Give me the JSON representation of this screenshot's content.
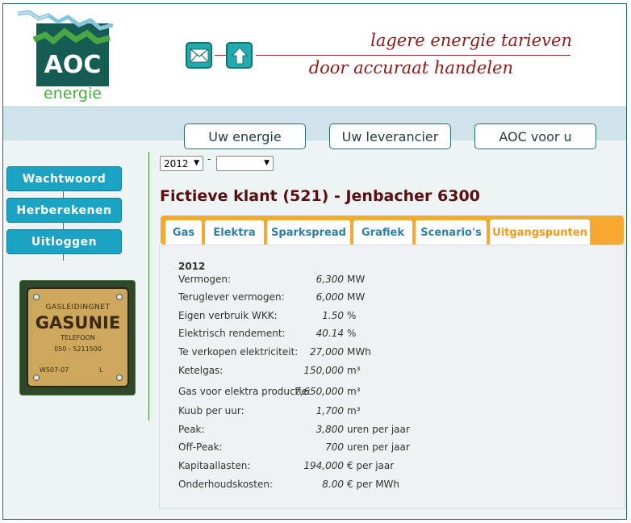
{
  "brand": {
    "name": "AOC",
    "sub": "energie",
    "tagline1": "lagere energie tarieven",
    "tagline2": "door accuraat handelen"
  },
  "header_icons": [
    {
      "name": "mail-icon"
    },
    {
      "name": "home-icon"
    }
  ],
  "nav": {
    "tabs": [
      {
        "label": "Uw energie"
      },
      {
        "label": "Uw leverancier"
      },
      {
        "label": "AOC voor u"
      }
    ]
  },
  "sidebar": {
    "buttons": [
      {
        "label": "Wachtwoord"
      },
      {
        "label": "Herberekenen"
      },
      {
        "label": "Uitloggen"
      }
    ],
    "photo": {
      "line1": "GASLEIDINGNET",
      "line2": "GASUNIE",
      "line3": "TELEFOON",
      "line4": "050 - 5211500",
      "line5": "W507-07",
      "line6": "L"
    }
  },
  "filters": {
    "year": "2012",
    "separator": "-",
    "second": ""
  },
  "page_title": "Fictieve klant (521) - Jenbacher 6300",
  "tabs": [
    {
      "label": "Gas"
    },
    {
      "label": "Elektra"
    },
    {
      "label": "Sparkspread"
    },
    {
      "label": "Grafiek"
    },
    {
      "label": "Scenario's"
    },
    {
      "label": "Uitgangspunten"
    }
  ],
  "active_tab": "Uitgangspunten",
  "panel": {
    "year": "2012",
    "rows": [
      {
        "label": "Vermogen:",
        "value": "6,300",
        "unit": "MW"
      },
      {
        "label": "Teruglever vermogen:",
        "value": "6,000",
        "unit": "MW"
      },
      {
        "label": "Eigen verbruik WKK:",
        "value": "1.50",
        "unit": "%"
      },
      {
        "label": "Elektrisch rendement:",
        "value": "40.14",
        "unit": "%"
      },
      {
        "label": "Te verkopen elektriciteit:",
        "value": "27,000",
        "unit": "MWh"
      },
      {
        "label": "Ketelgas:",
        "value": "150,000",
        "unit": "m³"
      },
      {
        "label": "Gas voor elektra productie:",
        "value": "7,650,000",
        "unit": "m³"
      },
      {
        "label": "Kuub per uur:",
        "value": "1,700",
        "unit": "m³"
      },
      {
        "label": "Peak:",
        "value": "3,800",
        "unit": "uren per jaar"
      },
      {
        "label": "Off-Peak:",
        "value": "700",
        "unit": "uren per jaar"
      },
      {
        "label": "Kapitaallasten:",
        "value": "194,000",
        "unit": "€ per jaar"
      },
      {
        "label": "Onderhoudskosten:",
        "value": "8.00",
        "unit": "€ per MWh"
      }
    ]
  },
  "colors": {
    "brand_dark": "#155c52",
    "brand_green": "#4aa843",
    "tagline": "#8b1a1a",
    "sidebar_button": "#1ca3c4",
    "tab_bar": "#f7a831",
    "tab_text": "#2c7fa7",
    "active_tab_text": "#f39a1d",
    "title": "#5b0e12"
  }
}
